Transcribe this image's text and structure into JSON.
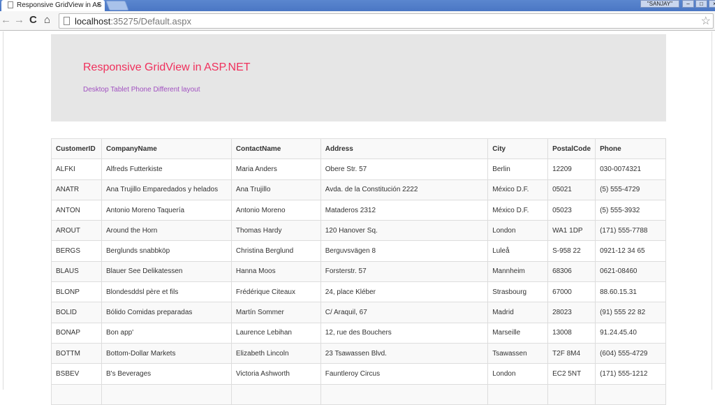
{
  "browser": {
    "tab_title": "Responsive GridView in AS",
    "url_host": "localhost",
    "url_rest": ":35275/Default.aspx",
    "user": "\"SANJAY\""
  },
  "hero": {
    "title": "Responsive GridView in ASP.NET",
    "subtitle": "Desktop Tablet Phone Different layout"
  },
  "table": {
    "columns": [
      "CustomerID",
      "CompanyName",
      "ContactName",
      "Address",
      "City",
      "PostalCode",
      "Phone"
    ],
    "rows": [
      [
        "ALFKI",
        "Alfreds Futterkiste",
        "Maria Anders",
        "Obere Str. 57",
        "Berlin",
        "12209",
        "030-0074321"
      ],
      [
        "ANATR",
        "Ana Trujillo Emparedados y helados",
        "Ana Trujillo",
        "Avda. de la Constitución 2222",
        "México D.F.",
        "05021",
        "(5) 555-4729"
      ],
      [
        "ANTON",
        "Antonio Moreno Taquería",
        "Antonio Moreno",
        "Mataderos 2312",
        "México D.F.",
        "05023",
        "(5) 555-3932"
      ],
      [
        "AROUT",
        "Around the Horn",
        "Thomas Hardy",
        "120 Hanover Sq.",
        "London",
        "WA1 1DP",
        "(171) 555-7788"
      ],
      [
        "BERGS",
        "Berglunds snabbköp",
        "Christina Berglund",
        "Berguvsvägen 8",
        "Luleå",
        "S-958 22",
        "0921-12 34 65"
      ],
      [
        "BLAUS",
        "Blauer See Delikatessen",
        "Hanna Moos",
        "Forsterstr. 57",
        "Mannheim",
        "68306",
        "0621-08460"
      ],
      [
        "BLONP",
        "Blondesddsl père et fils",
        "Frédérique Citeaux",
        "24, place Kléber",
        "Strasbourg",
        "67000",
        "88.60.15.31"
      ],
      [
        "BOLID",
        "Bólido Comidas preparadas",
        "Martín Sommer",
        "C/ Araquil, 67",
        "Madrid",
        "28023",
        "(91) 555 22 82"
      ],
      [
        "BONAP",
        "Bon app'",
        "Laurence Lebihan",
        "12, rue des Bouchers",
        "Marseille",
        "13008",
        "91.24.45.40"
      ],
      [
        "BOTTM",
        "Bottom-Dollar Markets",
        "Elizabeth Lincoln",
        "23 Tsawassen Blvd.",
        "Tsawassen",
        "T2F 8M4",
        "(604) 555-4729"
      ],
      [
        "BSBEV",
        "B's Beverages",
        "Victoria Ashworth",
        "Fauntleroy Circus",
        "London",
        "EC2 5NT",
        "(171) 555-1212"
      ],
      [
        "",
        "",
        "",
        "",
        "",
        "",
        ""
      ]
    ]
  }
}
